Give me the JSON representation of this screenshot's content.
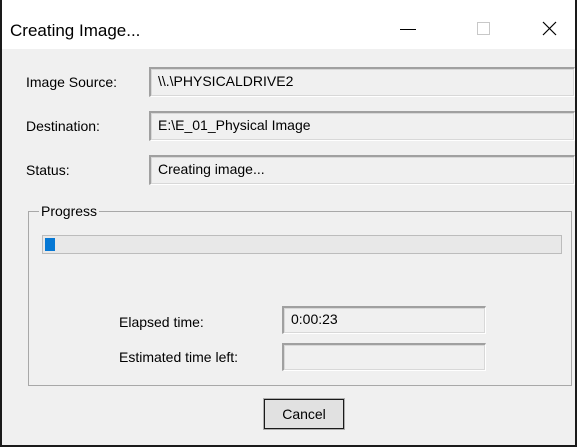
{
  "window": {
    "title": "Creating Image...",
    "controls": {
      "minimize_icon": "minimize-icon",
      "maximize_icon": "maximize-icon",
      "close_icon": "close-icon"
    }
  },
  "fields": {
    "image_source": {
      "label": "Image Source:",
      "value": "\\\\.\\PHYSICALDRIVE2"
    },
    "destination": {
      "label": "Destination:",
      "value": "E:\\E_01_Physical Image"
    },
    "status": {
      "label": "Status:",
      "value": "Creating image..."
    }
  },
  "progress": {
    "legend": "Progress",
    "fraction": 0.02,
    "color": "#0678d4",
    "elapsed_label": "Elapsed time:",
    "elapsed_value": "0:00:23",
    "estimated_label": "Estimated time left:",
    "estimated_value": ""
  },
  "buttons": {
    "cancel_label": "Cancel"
  }
}
